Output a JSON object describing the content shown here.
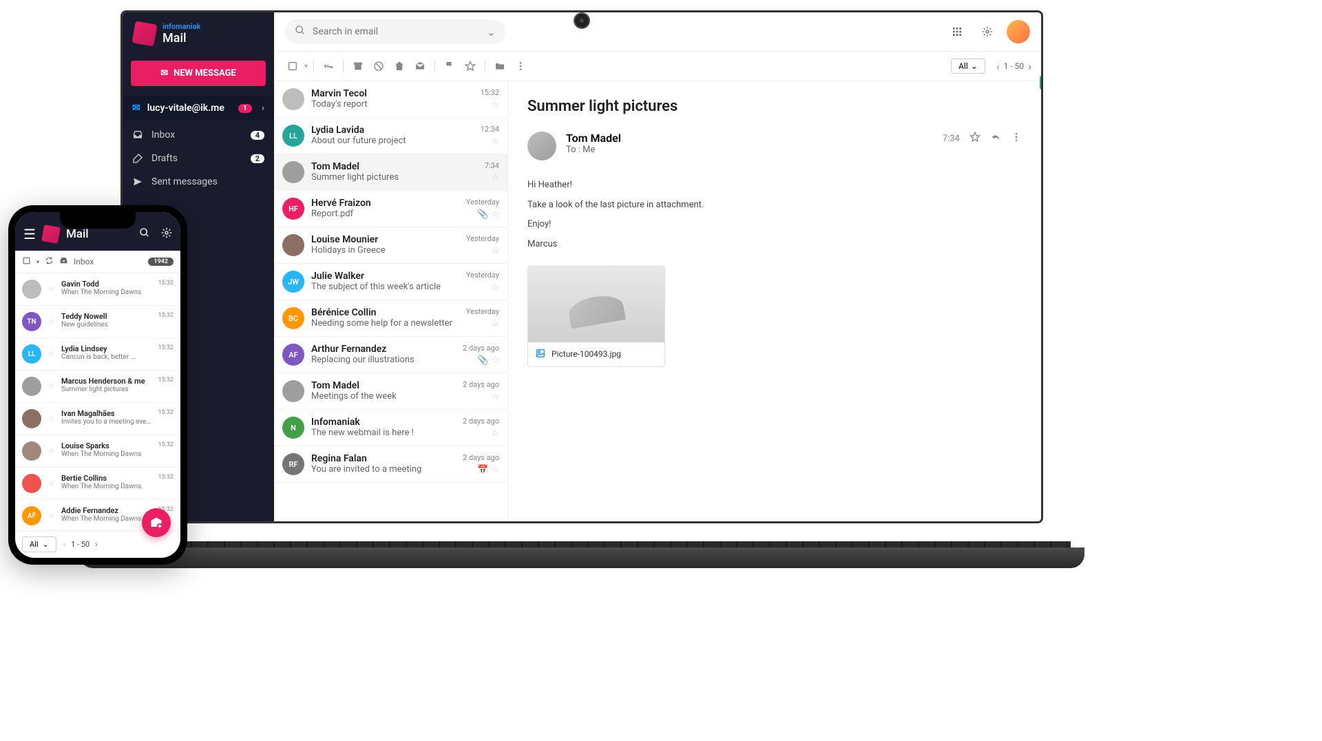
{
  "brand": {
    "tag": "infomaniak",
    "name": "Mail"
  },
  "compose_label": "NEW MESSAGE",
  "account": {
    "email": "lucy-vitale@ik.me",
    "badge": "1"
  },
  "folders": [
    {
      "label": "Inbox",
      "count": "4"
    },
    {
      "label": "Drafts",
      "count": "2"
    },
    {
      "label": "Sent messages",
      "count": ""
    }
  ],
  "search_placeholder": "Search in email",
  "toolbar": {
    "filter": "All",
    "page": "1 - 50"
  },
  "messages": [
    {
      "from": "Marvin Tecol",
      "subject": "Today's report",
      "time": "15:32",
      "av_bg": "#bdbdbd",
      "av_text": "",
      "attach": false,
      "cal": false
    },
    {
      "from": "Lydia Lavida",
      "subject": "About our future project",
      "time": "12:34",
      "av_bg": "#26a69a",
      "av_text": "LL",
      "attach": false,
      "cal": false
    },
    {
      "from": "Tom Madel",
      "subject": "Summer light pictures",
      "time": "7:34",
      "av_bg": "#9e9e9e",
      "av_text": "",
      "attach": false,
      "cal": false,
      "selected": true
    },
    {
      "from": "Hervé Fraizon",
      "subject": "Report.pdf",
      "time": "Yesterday",
      "av_bg": "#e91e63",
      "av_text": "HF",
      "attach": true,
      "cal": false
    },
    {
      "from": "Louise Mounier",
      "subject": "Holidays in Greece",
      "time": "Yesterday",
      "av_bg": "#8d6e63",
      "av_text": "",
      "attach": false,
      "cal": false
    },
    {
      "from": "Julie Walker",
      "subject": "The subject of this week's article",
      "time": "Yesterday",
      "av_bg": "#29b6f6",
      "av_text": "JW",
      "attach": false,
      "cal": false
    },
    {
      "from": "Bérénice Collin",
      "subject": "Needing some help for a newsletter",
      "time": "Yesterday",
      "av_bg": "#ff9800",
      "av_text": "BC",
      "attach": false,
      "cal": false
    },
    {
      "from": "Arthur Fernandez",
      "subject": "Replacing our illustrations",
      "time": "2 days ago",
      "av_bg": "#7e57c2",
      "av_text": "AF",
      "attach": true,
      "cal": false
    },
    {
      "from": "Tom Madel",
      "subject": "Meetings of the week",
      "time": "2 days ago",
      "av_bg": "#9e9e9e",
      "av_text": "",
      "attach": false,
      "cal": false
    },
    {
      "from": "Infomaniak",
      "subject": "The new webmail is here !",
      "time": "2 days ago",
      "av_bg": "#43a047",
      "av_text": "N",
      "attach": false,
      "cal": false
    },
    {
      "from": "Regina Falan",
      "subject": "You are invited to a meeting",
      "time": "2 days ago",
      "av_bg": "#757575",
      "av_text": "RF",
      "attach": false,
      "cal": true
    }
  ],
  "detail": {
    "subject": "Summer light pictures",
    "from": "Tom Madel",
    "to": "To : Me",
    "time": "7:34",
    "body": [
      "Hi Heather!",
      "Take a look of the last picture in attachment.",
      "Enjoy!",
      "Marcus"
    ],
    "attachment": "Picture-100493.jpg"
  },
  "phone": {
    "title": "Mail",
    "folder": "Inbox",
    "count": "1942",
    "filter": "All",
    "page": "1 - 50",
    "messages": [
      {
        "from": "Gavin Todd",
        "subject": "When The Morning Dawns",
        "time": "15:32",
        "av_bg": "#bdbdbd",
        "av_text": ""
      },
      {
        "from": "Teddy Nowell",
        "subject": "New guidelines",
        "time": "15:32",
        "av_bg": "#7e57c2",
        "av_text": "TN"
      },
      {
        "from": "Lydia Lindsey",
        "subject": "Cancun is back, better ...",
        "time": "15:32",
        "av_bg": "#29b6f6",
        "av_text": "LL"
      },
      {
        "from": "Marcus Henderson & me",
        "subject": "Summer light pictures",
        "time": "15:32",
        "av_bg": "#9e9e9e",
        "av_text": ""
      },
      {
        "from": "Ivan Magalhães",
        "subject": "Invites you to a meeting event",
        "time": "15:32",
        "av_bg": "#8d6e63",
        "av_text": ""
      },
      {
        "from": "Louise Sparks",
        "subject": "When The Morning Dawns",
        "time": "15:32",
        "av_bg": "#a1887f",
        "av_text": ""
      },
      {
        "from": "Bertie Collins",
        "subject": "When The Morning Dawns",
        "time": "15:32",
        "av_bg": "#ef5350",
        "av_text": ""
      },
      {
        "from": "Addie Fernandez",
        "subject": "When The Morning Dawns",
        "time": "15:32",
        "av_bg": "#ff9800",
        "av_text": "AF"
      }
    ]
  }
}
